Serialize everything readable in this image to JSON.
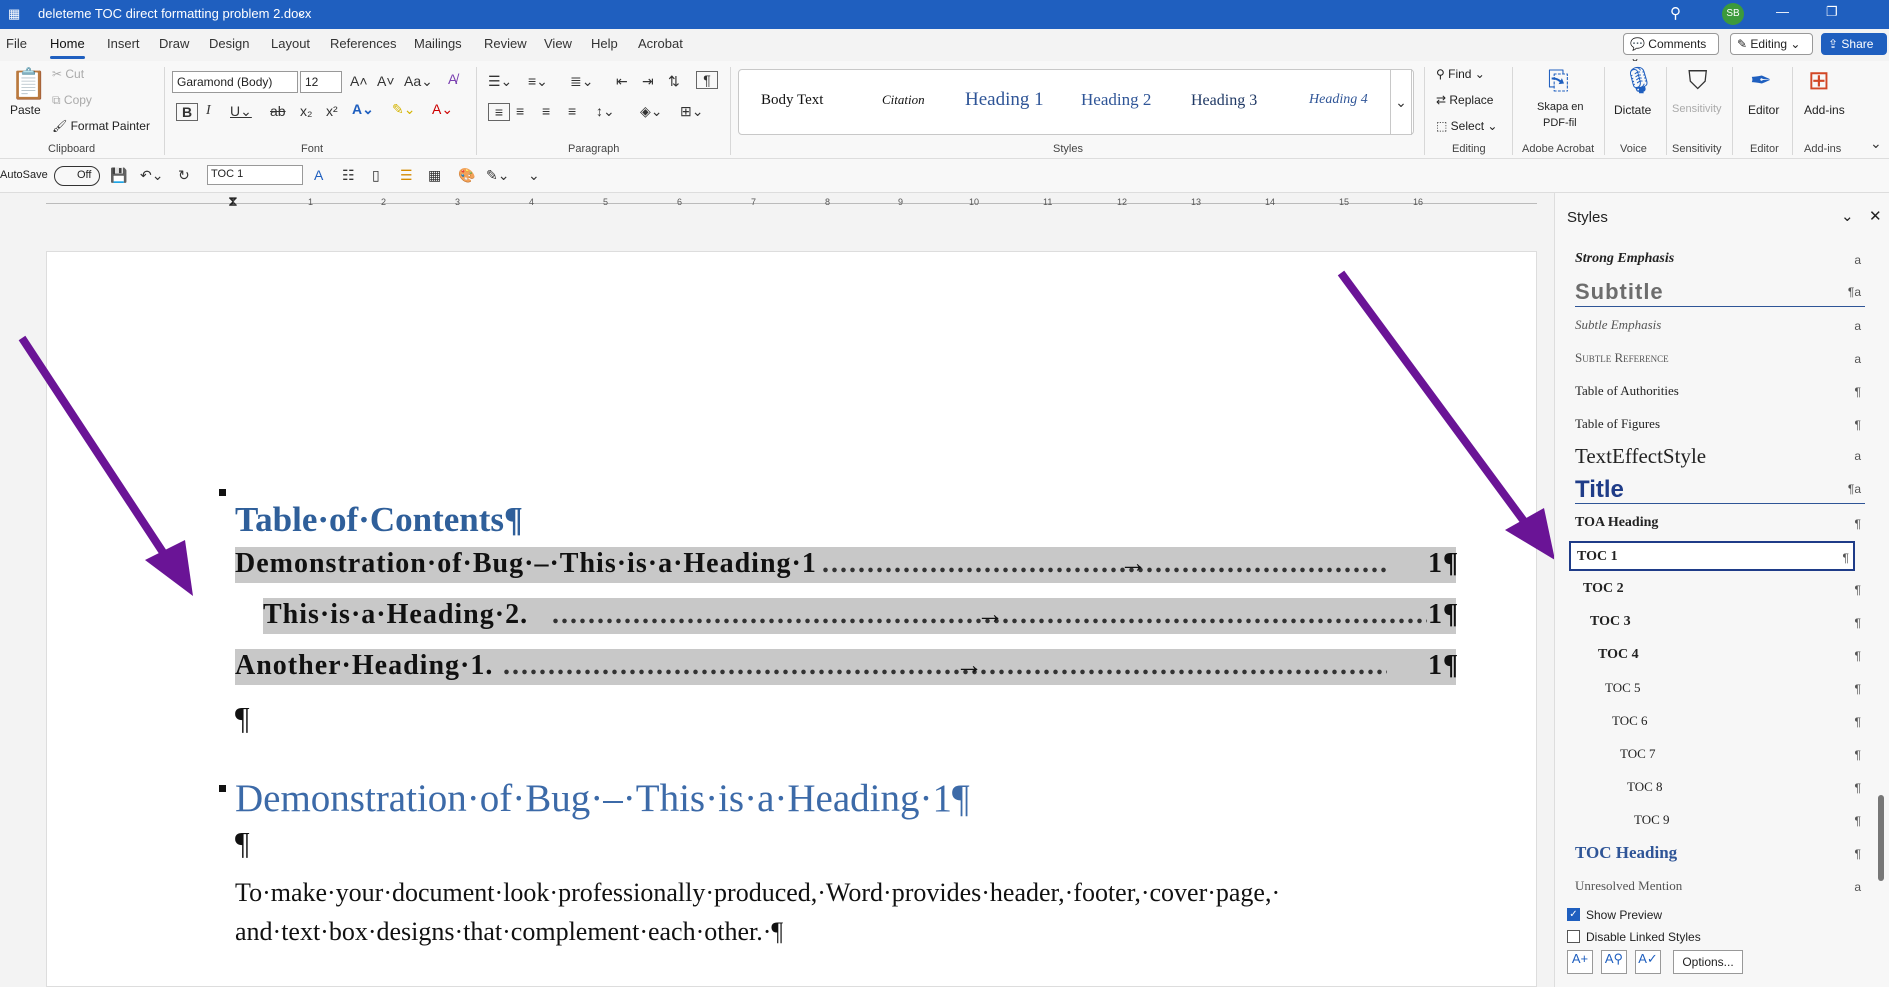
{
  "window": {
    "title": "deleteme TOC direct formatting problem 2.docx",
    "user_initials": "SB",
    "accent": "#1f5fbf"
  },
  "tabs": [
    "File",
    "Home",
    "Insert",
    "Draw",
    "Design",
    "Layout",
    "References",
    "Mailings",
    "Review",
    "View",
    "Help",
    "Acrobat"
  ],
  "topright": {
    "comments": "Comments",
    "editing": "Editing",
    "share": "Share"
  },
  "ribbon": {
    "clipboard": {
      "paste": "Paste",
      "cut": "Cut",
      "copy": "Copy",
      "painter": "Format Painter",
      "label": "Clipboard"
    },
    "font": {
      "name": "Garamond (Body)",
      "size": "12",
      "label": "Font"
    },
    "paragraph": {
      "label": "Paragraph"
    },
    "styles": {
      "items": [
        "Body Text",
        "Citation",
        "Heading 1",
        "Heading 2",
        "Heading 3",
        "Heading 4"
      ],
      "label": "Styles"
    },
    "editing": {
      "find": "Find",
      "replace": "Replace",
      "select": "Select",
      "label": "Editing"
    },
    "acrobat": {
      "btn1": "Skapa en",
      "btn2": "PDF-fil",
      "label": "Adobe Acrobat"
    },
    "voice": {
      "btn": "Dictate",
      "label": "Voice"
    },
    "sensitivity": {
      "btn": "Sensitivity",
      "label": "Sensitivity"
    },
    "editor": {
      "btn": "Editor",
      "label": "Editor"
    },
    "addins": {
      "btn": "Add-ins",
      "label": "Add-ins"
    }
  },
  "qat": {
    "autosave": "AutoSave",
    "toggle": "Off",
    "style_box": "TOC 1"
  },
  "ruler": [
    "1",
    "1",
    "2",
    "3",
    "4",
    "5",
    "6",
    "7",
    "8",
    "9",
    "10",
    "11",
    "12",
    "13",
    "14",
    "15",
    "16"
  ],
  "document": {
    "toc_title": "Table·of·Contents¶",
    "toc": [
      {
        "text": "Demonstration·of·Bug·–·This·is·a·Heading·1",
        "page": "1¶",
        "arrow": "→"
      },
      {
        "text": "This·is·a·Heading·2.",
        "page": "1¶",
        "arrow": "→"
      },
      {
        "text": "Another·Heading·1.",
        "page": "1¶",
        "arrow": "→"
      }
    ],
    "pilcrow": "¶",
    "heading1": "Demonstration·of·Bug·–·This·is·a·Heading·1¶",
    "body_line1": "To·make·your·document·look·professionally·produced,·Word·provides·header,·footer,·cover·page,·",
    "body_line2": "and·text·box·designs·that·complement·each·other.·¶"
  },
  "styles_pane": {
    "title": "Styles",
    "items": [
      {
        "name": "Strong Emphasis",
        "mark": "a"
      },
      {
        "name": "Subtitle",
        "mark": "¶a"
      },
      {
        "name": "Subtle Emphasis",
        "mark": "a"
      },
      {
        "name": "Subtle Reference",
        "mark": "a"
      },
      {
        "name": "Table of Authorities",
        "mark": "¶"
      },
      {
        "name": "Table of Figures",
        "mark": "¶"
      },
      {
        "name": "TextEffectStyle",
        "mark": "a"
      },
      {
        "name": "Title",
        "mark": "¶a"
      },
      {
        "name": "TOA Heading",
        "mark": "¶"
      },
      {
        "name": "TOC 1",
        "mark": "¶"
      },
      {
        "name": "TOC 2",
        "mark": "¶"
      },
      {
        "name": "TOC 3",
        "mark": "¶"
      },
      {
        "name": "TOC 4",
        "mark": "¶"
      },
      {
        "name": "TOC 5",
        "mark": "¶"
      },
      {
        "name": "TOC 6",
        "mark": "¶"
      },
      {
        "name": "TOC 7",
        "mark": "¶"
      },
      {
        "name": "TOC 8",
        "mark": "¶"
      },
      {
        "name": "TOC 9",
        "mark": "¶"
      },
      {
        "name": "TOC Heading",
        "mark": "¶"
      },
      {
        "name": "Unresolved Mention",
        "mark": "a"
      }
    ],
    "show_preview": "Show Preview",
    "disable_linked": "Disable Linked Styles",
    "options": "Options..."
  }
}
